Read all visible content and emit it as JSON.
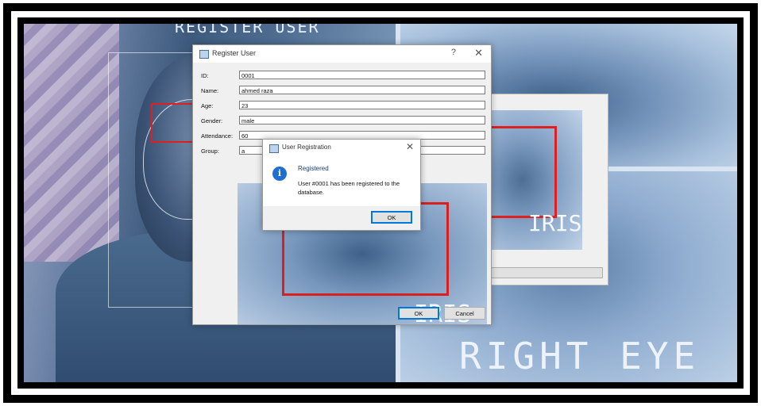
{
  "background": {
    "top_label": "REGISTER USER",
    "right_eye_label": "RIGHT EYE",
    "back_window_iris_label": "IRIS"
  },
  "register_dialog": {
    "title": "Register User",
    "help_glyph": "?",
    "close_glyph": "✕",
    "fields": [
      {
        "label": "ID:",
        "value": "0001"
      },
      {
        "label": "Name:",
        "value": "ahmed raza"
      },
      {
        "label": "Age:",
        "value": "23"
      },
      {
        "label": "Gender:",
        "value": "male"
      },
      {
        "label": "Attendance:",
        "value": "60"
      },
      {
        "label": "Group:",
        "value": "a"
      }
    ],
    "preview_label": "IRIS",
    "ok_label": "OK",
    "cancel_label": "Cancel"
  },
  "message_box": {
    "title": "User Registration",
    "close_glyph": "✕",
    "icon": "info-icon",
    "icon_glyph": "i",
    "heading": "Registered",
    "body": "User #0001  has been registered to the database.",
    "ok_label": "OK"
  },
  "colors": {
    "detection_box": "#e02020",
    "accent": "#0078d7",
    "info_icon": "#1f6fd1"
  }
}
